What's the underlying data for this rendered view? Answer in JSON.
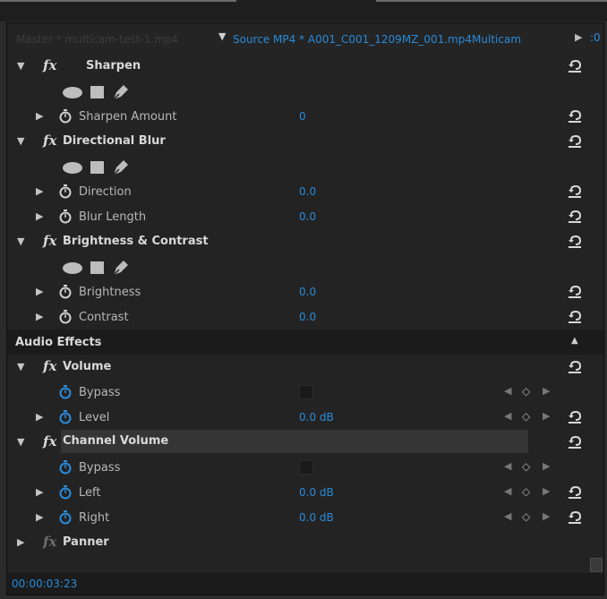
{
  "header": {
    "master_label": "Master * multicam-test-1.mp4",
    "source_arrow": "▼",
    "source_label": "Source MP4 * A001_C001_1209MZ_001.mp4Multicam",
    "play_icon": "▶",
    "timeline_cut": ":0"
  },
  "video_effects": [
    {
      "name": "Sharpen",
      "params": [
        {
          "name": "Sharpen Amount",
          "value": "0"
        }
      ]
    },
    {
      "name": "Directional Blur",
      "params": [
        {
          "name": "Direction",
          "value": "0.0"
        },
        {
          "name": "Blur Length",
          "value": "0.0"
        }
      ]
    },
    {
      "name": "Brightness & Contrast",
      "params": [
        {
          "name": "Brightness",
          "value": "0.0"
        },
        {
          "name": "Contrast",
          "value": "0.0"
        }
      ]
    }
  ],
  "audio_section": {
    "title": "Audio Effects",
    "collapse_icon": "▲"
  },
  "audio_effects": [
    {
      "name": "Volume",
      "params": [
        {
          "name": "Bypass",
          "value": ""
        },
        {
          "name": "Level",
          "value": "0.0 dB"
        }
      ]
    },
    {
      "name": "Channel Volume",
      "params": [
        {
          "name": "Bypass",
          "value": ""
        },
        {
          "name": "Left",
          "value": "0.0 dB"
        },
        {
          "name": "Right",
          "value": "0.0 dB"
        }
      ]
    },
    {
      "name": "Panner"
    }
  ],
  "glyphs": {
    "twirl_down": "▼",
    "twirl_right": "▶",
    "fx": "fx",
    "kf_prev": "◀",
    "kf_add": "◇",
    "kf_next": "▶"
  },
  "footer": {
    "timecode": "00:00:03:23"
  },
  "colors": {
    "accent_blue": "#2a8ad8",
    "panel_bg": "#232323",
    "section_bg": "#1b1b1b"
  }
}
